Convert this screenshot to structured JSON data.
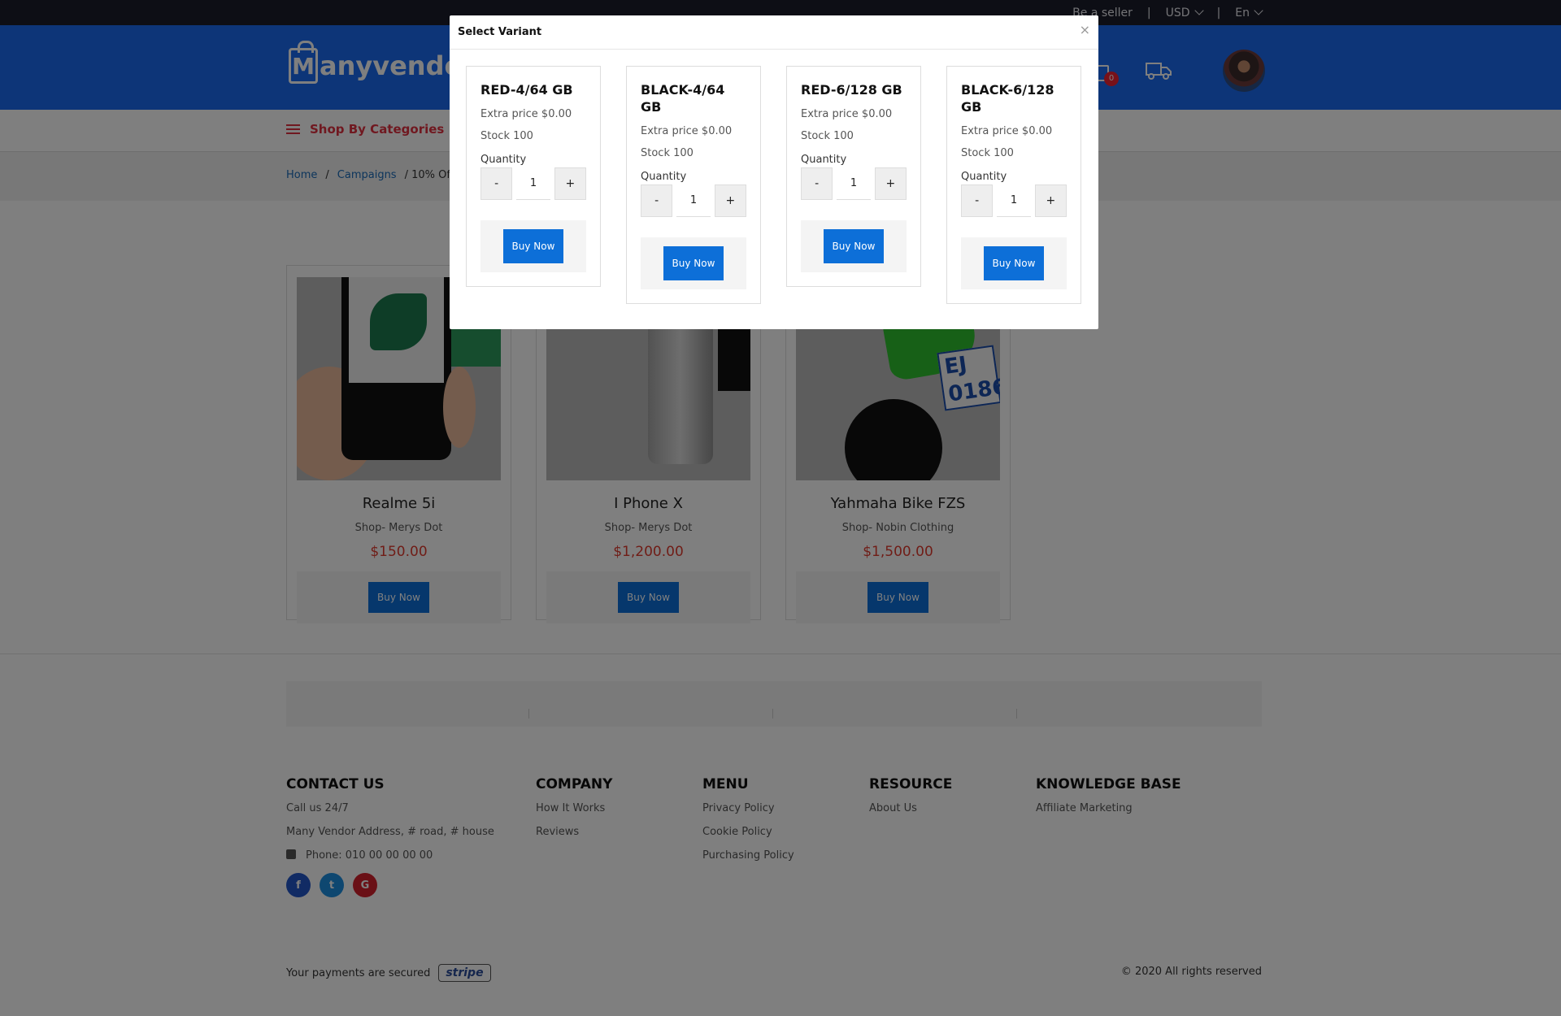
{
  "topbar": {
    "seller": "Be a seller",
    "currency": "USD",
    "language": "En"
  },
  "header": {
    "logo": "Manyvendor",
    "cart_count": "0"
  },
  "nav": {
    "categories": "Shop By Categories"
  },
  "breadcrumb": {
    "home": "Home",
    "campaigns": "Campaigns",
    "current": "/ 10% Of"
  },
  "products": [
    {
      "name": "Realme 5i",
      "shop": "Shop- Merys Dot",
      "price": "$150.00",
      "buy": "Buy Now"
    },
    {
      "name": "I Phone X",
      "shop": "Shop- Merys Dot",
      "price": "$1,200.00",
      "buy": "Buy Now"
    },
    {
      "name": "Yahmaha Bike FZS",
      "shop": "Shop- Nobin Clothing",
      "price": "$1,500.00",
      "buy": "Buy Now"
    }
  ],
  "footer": {
    "contact": {
      "title": "CONTACT US",
      "line1": "Call us 24/7",
      "line2": "Many Vendor Address, # road, # house",
      "phone": "Phone: 010 00 00 00 00"
    },
    "company": {
      "title": "COMPANY",
      "items": [
        "How It Works",
        "Reviews"
      ]
    },
    "menu": {
      "title": "MENU",
      "items": [
        "Privacy Policy",
        "Cookie Policy",
        "Purchasing Policy"
      ]
    },
    "resource": {
      "title": "RESOURCE",
      "items": [
        "About Us"
      ]
    },
    "knowledge": {
      "title": "KNOWLEDGE BASE",
      "items": [
        "Affiliate Marketing"
      ]
    },
    "secure": "Your payments are secured",
    "stripe": "stripe",
    "rights": "© 2020 All rights reserved"
  },
  "modal": {
    "title": "Select Variant",
    "close": "×",
    "variants": [
      {
        "name": "RED-4/64 GB",
        "extra": "Extra price $0.00",
        "stock": "Stock 100",
        "qty_label": "Quantity",
        "minus": "-",
        "qty": "1",
        "plus": "+",
        "buy": "Buy Now"
      },
      {
        "name": "BLACK-4/64 GB",
        "extra": "Extra price $0.00",
        "stock": "Stock 100",
        "qty_label": "Quantity",
        "minus": "-",
        "qty": "1",
        "plus": "+",
        "buy": "Buy Now"
      },
      {
        "name": "RED-6/128 GB",
        "extra": "Extra price $0.00",
        "stock": "Stock 100",
        "qty_label": "Quantity",
        "minus": "-",
        "qty": "1",
        "plus": "+",
        "buy": "Buy Now"
      },
      {
        "name": "BLACK-6/128 GB",
        "extra": "Extra price $0.00",
        "stock": "Stock 100",
        "qty_label": "Quantity",
        "minus": "-",
        "qty": "1",
        "plus": "+",
        "buy": "Buy Now"
      }
    ]
  },
  "colors": {
    "brand_blue": "#1b6bf0",
    "button_blue": "#0d6fd8",
    "price_red": "#e03b2f",
    "topbar": "#1b1c2a"
  },
  "icons": [
    "chevron-down-icon",
    "cart-icon",
    "truck-icon",
    "menu-icon",
    "phone-icon",
    "facebook-icon",
    "twitter-icon",
    "google-icon",
    "close-icon"
  ]
}
